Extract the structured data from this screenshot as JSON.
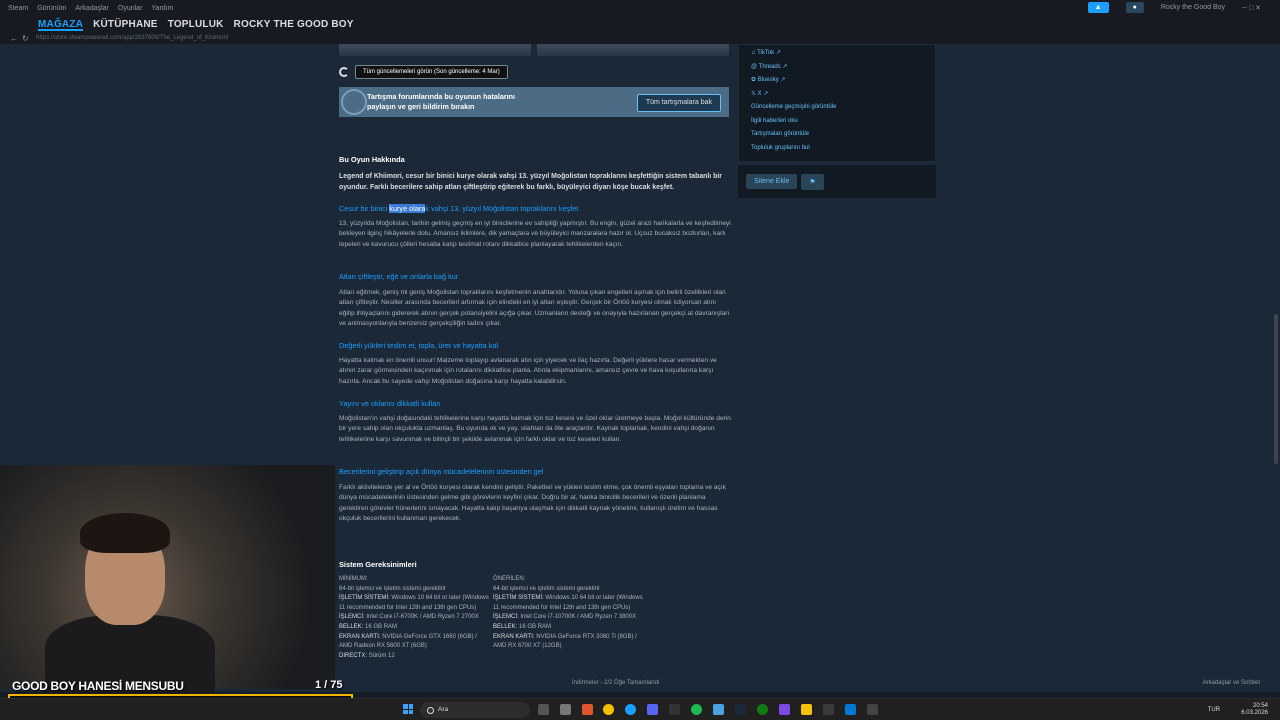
{
  "menu": {
    "items": [
      "Steam",
      "Görünüm",
      "Arkadaşlar",
      "Oyunlar",
      "Yardım"
    ],
    "user": "Rocky the Good Boy"
  },
  "nav": {
    "items": [
      "MAĞAZA",
      "KÜTÜPHANE",
      "TOPLULUK",
      "ROCKY THE GOOD BOY"
    ]
  },
  "url": "https://store.steampowered.com/app/2637600/The_Legend_of_Khiimori/",
  "updates": {
    "label": "Tüm güncellemeleri görün (Son güncelleme: 4 Mar)"
  },
  "forum": {
    "line1": "Tartışma forumlarında bu oyunun hatalarını",
    "line2": "paylaşın ve geri bildirim bırakın",
    "button": "Tüm tartışmalara bak"
  },
  "about": {
    "title": "Bu Oyun Hakkında",
    "intro": "Legend of Khiimori, cesur bir binici kurye olarak vahşi 13. yüzyıl Moğolistan topraklarını keşfettiğin sistem tabanlı bir oyundur. Farklı becerilere sahip atları çiftleştirip eğiterek bu farklı, büyüleyici diyarı köşe bucak keşfet.",
    "s1_pre": "Cesur bir binici ",
    "s1_hl": "kurye olara",
    "s1_post": "k vahşi 13. yüzyıl Moğolistan topraklarını keşfet",
    "p1": "13. yüzyılda Moğolistan, tarihin gelmiş geçmiş en iyi binicilerine ev sahipliği yapmıştır. Bu engin, güzel arazi harikalarla ve keşfedilmeyi bekleyen ilginç hikâyelerle dolu. Amansız iklimlere, dik yamaçlara ve büyüleyici manzaralara hazır ol. Uçsuz bucaksız bozkırları, karlı tepeleri ve kavurucu çölleri hesaba katıp teslimat rotanı dikkatlice planlayarak tehlikelerden kaçın.",
    "s2": "Atları çiftleştir, eğit ve onlarla bağ kur",
    "p2": "Atları eğitmek, geniş mi geniş Moğolistan topraklarını keşfetmenin anahtarıdır. Yoluna çıkan engelleri aşmak için belirli özellikleri olan atları çiftleştir. Nesiller arasında becerileri artırmak için elindeki en iyi atları eşleştir. Gerçek bir Örtöö kuryesi olmak istiyorsan atını eğitip ihtiyaçlarını gidererek atının gerçek potansiyelini açığa çıkar. Uzmanların desteği ve onayıyla hazırlanan gerçekçi at davranışları ve animasyonlarıyla benzersiz gerçekçiliğin tadını çıkar.",
    "s3": "Değerli yükleri teslim et, topla, üret ve hayatta kal",
    "p3": "Hayatta kalmak en önemli unsur! Malzeme toplayıp avlanarak atın için yiyecek ve ilaç hazırla. Değerli yüklere hasar vermekten ve atının zarar görmesinden kaçınmak için rotalarını dikkatlice planla. Atınla ekipmanlarını, amansız çevre ve hava koşullarına karşı hazırla. Ancak bu sayede vahşi Moğolistan doğasına karşı hayatta kalabilirsin.",
    "s4": "Yayını ve oklarını dikkatli kullan",
    "p4": "Moğolistan'ın vahşi doğasındaki tehlikelerine karşı hayatta kalmak için toz kesesi ve özel oklar üretmeye başla. Moğol kültüründe derin bir yere sahip olan okçulukta uzmanlaş. Bu oyunda ok ve yay, silahtan da öte araçlardır. Kaynak toplamak, kendini vahşi doğanın tehlikelerine karşı savunmak ve bilinçli bir şekilde avlanmak için farklı oklar ve toz keseleri kullan.",
    "s5": "Becerilerini geliştirip açık dünya mücadelelerinin üstesinden gel",
    "p5": "Farklı aktivitelerde yer al ve Örtöö kuryesi olarak kendini geliştir. Paketleri ve yükleri teslim etme, çok önemli eşyaları toplama ve açık dünya mücadelelerinin üstesinden gelme gibi görevlerin keyfini çıkar. Doğru bir at, harika binicilik becerileri ve özenli planlama gerektiren görevler hünerlerini sınayacak. Hayatta kalıp başarıya ulaşmak için dikkatli kaynak yönetimi, kullanışlı üretim ve hassas okçuluk becerilerini kullanman gerekecek."
  },
  "requirements": {
    "title": "Sistem Gereksinimleri",
    "min": {
      "label": "MİNİMUM:",
      "l1": "64-bit işlemci ve işletim sistemi gerektirir",
      "os": "İŞLETİM SİSTEMİ:",
      "os_v": "Windows 10 64 bit or later (Windows 11 recommended for Intel 12th and 13th gen CPUs)",
      "cpu": "İŞLEMCİ:",
      "cpu_v": "Intel Core i7-6700K / AMD Ryzen 7 2700X",
      "ram": "BELLEK:",
      "ram_v": "16 GB RAM",
      "gpu": "EKRAN KARTI:",
      "gpu_v": "NVIDIA GeForce GTX 1660 (6GB) / AMD Radeon RX 5600 XT (6GB)",
      "dx": "DIRECTX:",
      "dx_v": "Sürüm 12"
    },
    "rec": {
      "label": "ÖNERİLEN:",
      "l1": "64-bit işlemci ve işletim sistemi gerektirir",
      "os": "İŞLETİM SİSTEMİ:",
      "os_v": "Windows 10 64 bit or later (Windows 11 recommended for Intel 12th and 13th gen CPUs)",
      "cpu": "İŞLEMCİ:",
      "cpu_v": "Intel Core i7-10700K / AMD Ryzen 7 3800X",
      "ram": "BELLEK:",
      "ram_v": "16 GB RAM",
      "gpu": "EKRAN KARTI:",
      "gpu_v": "NVIDIA GeForce RTX 3060 Ti (8GB) / AMD RX 6700 XT (12GB)"
    }
  },
  "sidebar": {
    "links": [
      "TikTok",
      "Threads",
      "Bluesky",
      "X",
      "Güncelleme geçmişini görüntüle",
      "İlgili haberleri oku",
      "Tartışmaları görüntüle",
      "Topluluk gruplarını bul"
    ],
    "wishlist": "Sitene Ekle"
  },
  "overlay": {
    "name": "GOOD BOY HANESİ MENSUBU",
    "count": "1 / 75"
  },
  "status": {
    "downloads": "İndirmeler - 2/2 Öğe Tamamlandı",
    "friends": "Arkadaşlar ve Sohbet"
  },
  "taskbar": {
    "search": "Ara",
    "lang": "TUR",
    "time": "20:54",
    "date": "6.03.2026"
  },
  "colors": {
    "accent": "#1a9fff",
    "overlay": "#f0b400"
  }
}
